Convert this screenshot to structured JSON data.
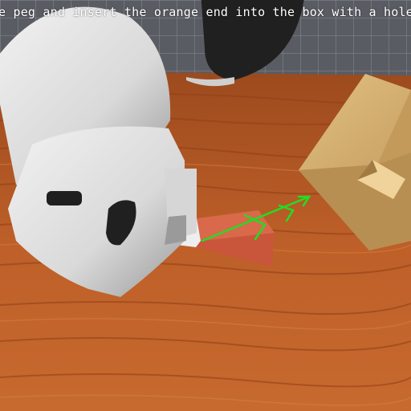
{
  "task": {
    "instruction": "e peg and insert the orange end into the box with a hole in it."
  },
  "colors": {
    "floor": "#55575e",
    "table": "#b65a26",
    "box": "#cfa668",
    "peg_orange": "#c9563a",
    "peg_white": "#eeeeee",
    "robot_body": "#e0e0e0",
    "arrow": "#22dd22"
  }
}
